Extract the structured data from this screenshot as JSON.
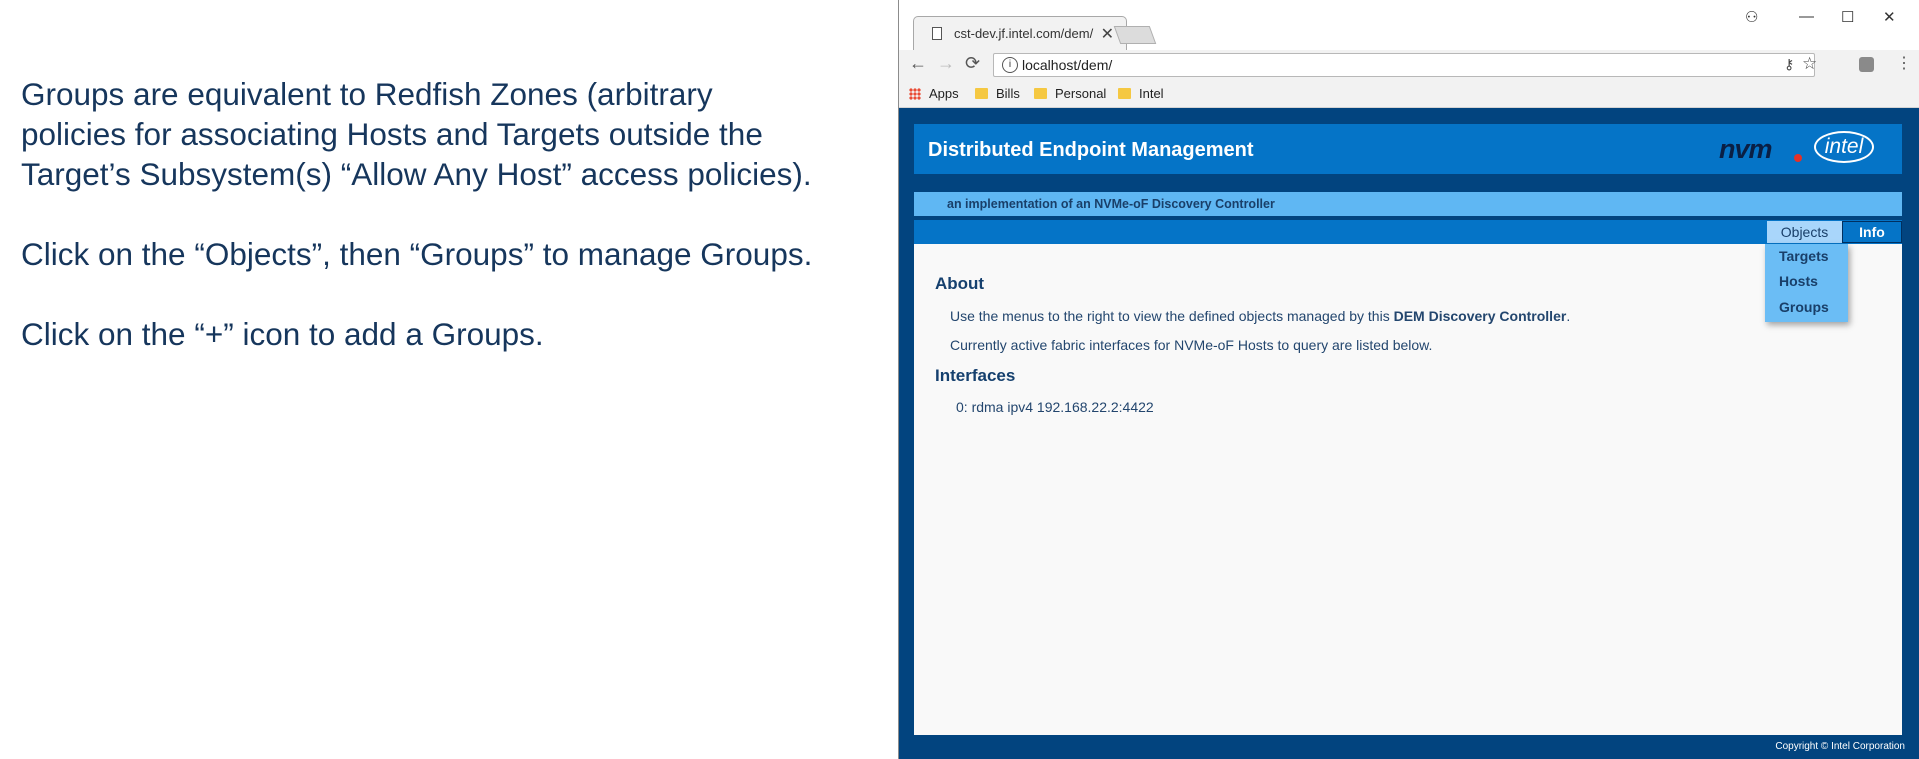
{
  "notes": {
    "para1_line1": "Groups are equivalent to Redfish Zones (arbitrary",
    "para1_line2": "policies for associating Hosts and Targets outside the",
    "para1_line3": "Target’s Subsystem(s) “Allow Any Host” access policies).",
    "para2": "Click on the “Objects”, then “Groups” to manage Groups.",
    "para3": "Click on the “+” icon to add a Groups."
  },
  "browser": {
    "tab_title": "cst-dev.jf.intel.com/dem/",
    "tab_close": "✕",
    "window_controls": {
      "minimize": "—",
      "maximize": "☐",
      "close": "✕"
    },
    "url": "localhost/dem/",
    "nav": {
      "back": "←",
      "forward": "→",
      "reload": "⟳"
    },
    "bookmarks": [
      "Apps",
      "Bills",
      "Personal",
      "Intel"
    ]
  },
  "app": {
    "title": "Distributed Endpoint Management",
    "logo_nvm": "nvm",
    "logo_intel": "intel",
    "subtitle": "an implementation of an NVMe-oF Discovery Controller",
    "menu": {
      "objects": "Objects",
      "info": "Info"
    },
    "dropdown": [
      "Targets",
      "Hosts",
      "Groups"
    ],
    "about_heading": "About",
    "about_line1_pre": "Use the menus to the right to view the defined objects managed by this ",
    "about_line1_bold": "DEM Discovery Controller",
    "about_line1_post": ".",
    "about_line2": "Currently active fabric interfaces for NVMe-oF Hosts to query are listed below.",
    "interfaces_heading": "Interfaces",
    "interfaces": [
      "0:  rdma ipv4 192.168.22.2:4422"
    ],
    "footer": "Copyright © Intel Corporation"
  },
  "colors": {
    "page_bg": "#02447f",
    "header": "#0574c7",
    "subtitle_bar": "#5fb7f3",
    "text_dark": "#16365c"
  }
}
